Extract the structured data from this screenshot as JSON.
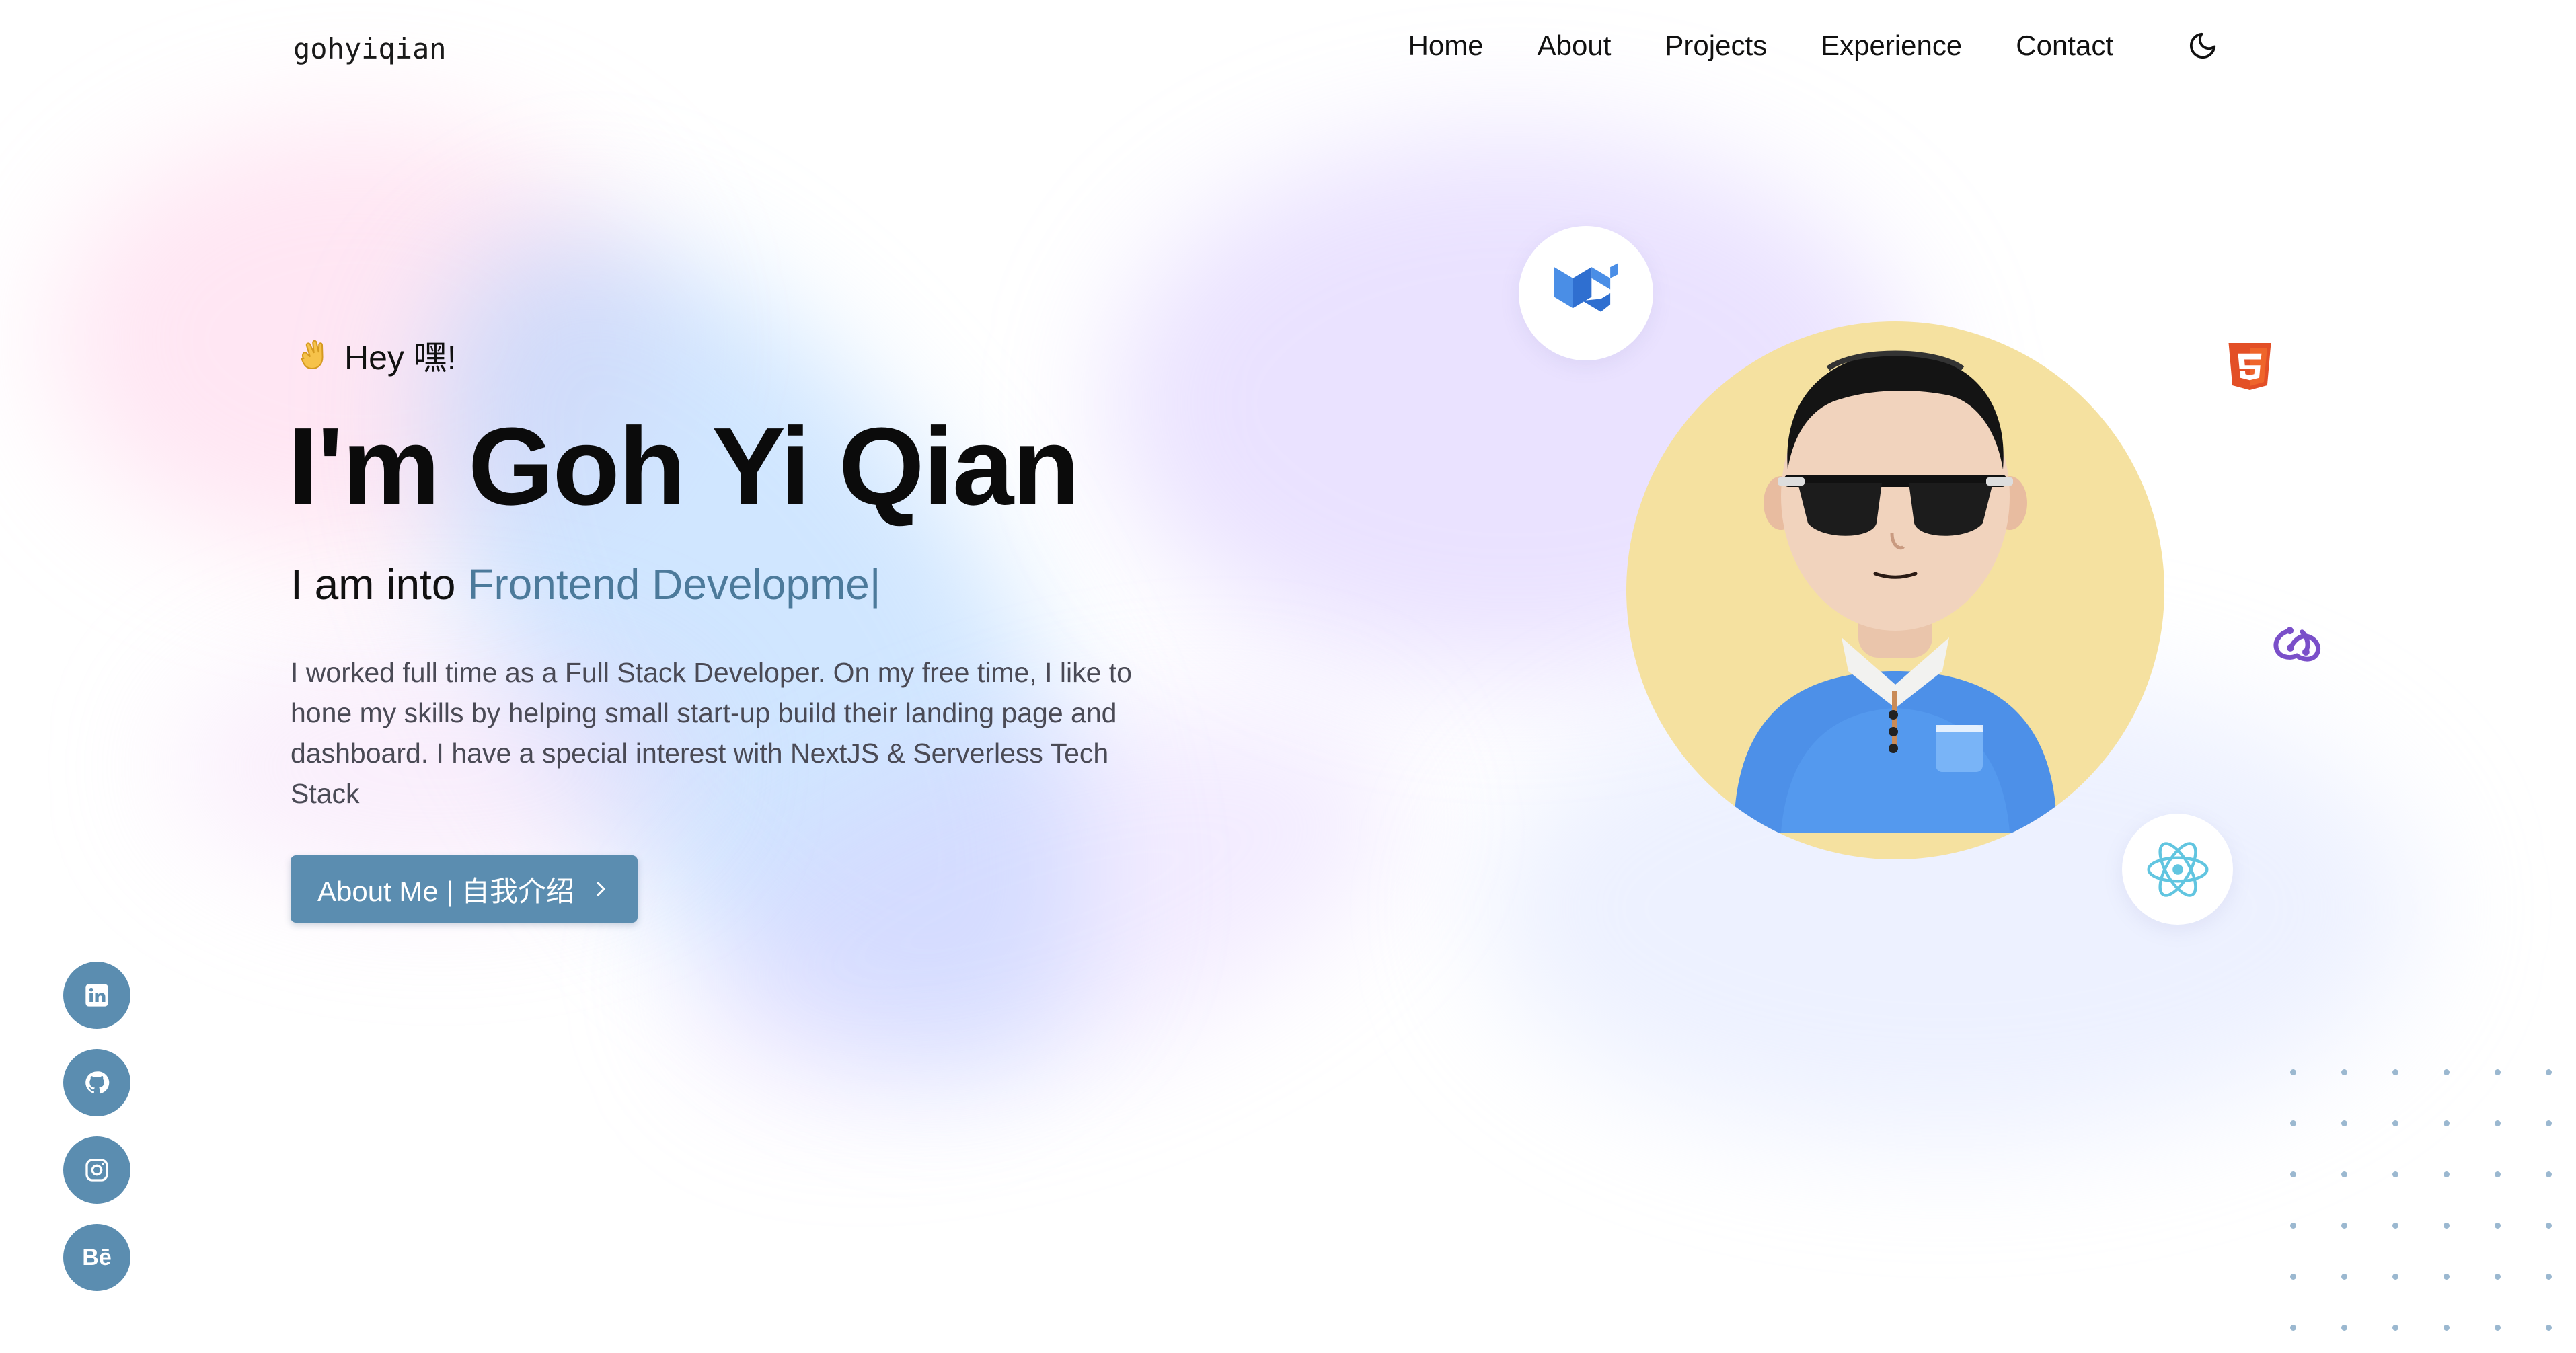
{
  "brand": "gohyiqian",
  "nav": {
    "items": [
      "Home",
      "About",
      "Projects",
      "Experience",
      "Contact"
    ],
    "theme_toggle_icon": "moon-icon"
  },
  "hero": {
    "greeting_icon": "waving-hand-icon",
    "greeting": "Hey 嘿!",
    "title": "I'm Goh Yi Qian",
    "subtitle_prefix": "I am into",
    "subtitle_highlight": "Frontend Developme",
    "subtitle_cursor": "|",
    "bio": "I worked full time as a Full Stack Developer. On my free time, I like to hone my skills by helping small start-up build their landing page and dashboard. I have a special interest with NextJS & Serverless Tech Stack",
    "cta_label": "About Me | 自我介绍",
    "cta_icon": "chevron-right-icon"
  },
  "social": [
    {
      "icon": "linkedin-icon",
      "name": "LinkedIn"
    },
    {
      "icon": "github-icon",
      "name": "GitHub"
    },
    {
      "icon": "instagram-icon",
      "name": "Instagram"
    },
    {
      "icon": "behance-icon",
      "name": "Behance",
      "glyph": "Bē"
    }
  ],
  "tech_icons": [
    "mui-icon",
    "html5-icon",
    "redux-icon",
    "react-icon"
  ],
  "colors": {
    "accent": "#5b8db0",
    "highlight_text": "#4c7a9b",
    "avatar_bg": "#f5e1a0",
    "text_dark": "#0b0b0b",
    "text_muted": "#4a4a55"
  }
}
